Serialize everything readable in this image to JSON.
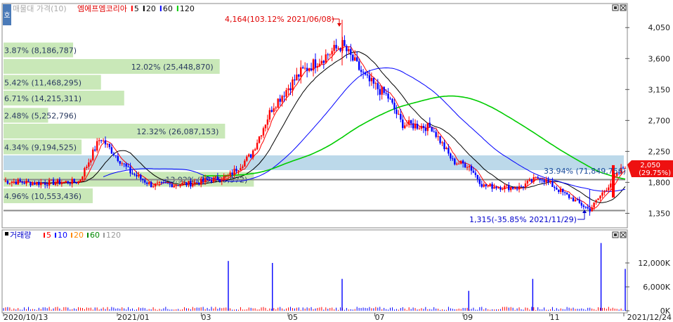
{
  "header": {
    "menu_label": "호",
    "title": "매물대 가격(10)",
    "stock_name": "엠에프엠코리아",
    "ma_legend": [
      {
        "label": "5",
        "color": "#ff0000"
      },
      {
        "label": "20",
        "color": "#000000"
      },
      {
        "label": "60",
        "color": "#0000ff"
      },
      {
        "label": "120",
        "color": "#00cc00"
      }
    ]
  },
  "volume_header": {
    "title": "거래량",
    "ma_legend": [
      {
        "label": "5",
        "color": "#ff0000"
      },
      {
        "label": "10",
        "color": "#0000ff"
      },
      {
        "label": "20",
        "color": "#ff8800"
      },
      {
        "label": "60",
        "color": "#008800"
      },
      {
        "label": "120",
        "color": "#999999"
      }
    ]
  },
  "annotations": {
    "high": "4,164(103.12% 2021/06/08)",
    "low": "1,315(-35.85% 2021/11/29)",
    "current_band": "33.94% (71,849,756)",
    "last_price": "2,050",
    "last_change": "(29.75%)"
  },
  "colors": {
    "up": "#ff0000",
    "down": "#0000ff",
    "ma5": "#ff0000",
    "ma20": "#000000",
    "ma60": "#0000ff",
    "ma120": "#00cc00",
    "profile": "#c9e8b8",
    "profile_current": "#bcd9ea"
  },
  "chart_data": [
    {
      "type": "candlestick",
      "title": "엠에프엠코리아",
      "x_tick_labels": [
        "2020/10/13",
        "2021/01",
        "03",
        "05",
        "07",
        "09",
        "11",
        "2021/12/24"
      ],
      "y_tick_labels": [
        "4,050",
        "3,600",
        "3,150",
        "2,700",
        "2,250",
        "1,800",
        "1,350"
      ],
      "ylim": [
        1150,
        4400
      ],
      "high": {
        "value": 4164,
        "pct": "103.12%",
        "date": "2021/06/08"
      },
      "low": {
        "value": 1315,
        "pct": "-35.85%",
        "date": "2021/11/29"
      },
      "last": {
        "value": 2050,
        "change_pct": "29.75%"
      },
      "moving_averages": [
        "5",
        "20",
        "60",
        "120"
      ],
      "price_reference_lines": [
        1840,
        1390
      ],
      "price_series_approx": [
        {
          "date": "2020-10-13",
          "close": 1820
        },
        {
          "date": "2020-11-05",
          "close": 1790
        },
        {
          "date": "2020-12-05",
          "close": 1810
        },
        {
          "date": "2020-12-20",
          "close": 2450
        },
        {
          "date": "2021-01-10",
          "close": 1950
        },
        {
          "date": "2021-01-25",
          "close": 1760
        },
        {
          "date": "2021-02-20",
          "close": 1780
        },
        {
          "date": "2021-03-20",
          "close": 1880
        },
        {
          "date": "2021-04-05",
          "close": 2200
        },
        {
          "date": "2021-04-20",
          "close": 2900
        },
        {
          "date": "2021-05-10",
          "close": 3400
        },
        {
          "date": "2021-06-08",
          "close": 3800
        },
        {
          "date": "2021-06-25",
          "close": 3300
        },
        {
          "date": "2021-07-10",
          "close": 3050
        },
        {
          "date": "2021-07-20",
          "close": 2650
        },
        {
          "date": "2021-08-10",
          "close": 2600
        },
        {
          "date": "2021-08-25",
          "close": 2100
        },
        {
          "date": "2021-09-05",
          "close": 2050
        },
        {
          "date": "2021-09-15",
          "close": 1750
        },
        {
          "date": "2021-10-10",
          "close": 1720
        },
        {
          "date": "2021-10-25",
          "close": 1880
        },
        {
          "date": "2021-11-10",
          "close": 1650
        },
        {
          "date": "2021-11-29",
          "close": 1400
        },
        {
          "date": "2021-12-10",
          "close": 1700
        },
        {
          "date": "2021-12-24",
          "close": 2050
        }
      ],
      "volume_profile": [
        {
          "label": "3.87% (8,186,787)",
          "pct": 3.87,
          "price": 3720
        },
        {
          "label": "12.02% (25,448,870)",
          "pct": 12.02,
          "price": 3480
        },
        {
          "label": "5.42% (11,468,295)",
          "pct": 5.42,
          "price": 3250
        },
        {
          "label": "6.71% (14,215,311)",
          "pct": 6.71,
          "price": 3020
        },
        {
          "label": "2.48% (5,252,796)",
          "pct": 2.48,
          "price": 2770
        },
        {
          "label": "12.32% (26,087,153)",
          "pct": 12.32,
          "price": 2540
        },
        {
          "label": "4.34% (9,194,525)",
          "pct": 4.34,
          "price": 2310
        },
        {
          "label": "33.94% (71,849,756)",
          "pct": 33.94,
          "price": 2080,
          "current": true
        },
        {
          "label": "13.92% (29,465,972)",
          "pct": 13.92,
          "price": 1840
        },
        {
          "label": "4.96% (10,553,436)",
          "pct": 4.96,
          "price": 1600
        }
      ]
    },
    {
      "type": "bar",
      "title": "거래량",
      "y_tick_labels": [
        "12,000K",
        "6,000K",
        "0K"
      ],
      "ylim": [
        0,
        18000
      ],
      "volume_spikes_approx": [
        {
          "date": "2021-03-20",
          "value": 12500
        },
        {
          "date": "2021-04-20",
          "value": 12000
        },
        {
          "date": "2021-06-08",
          "value": 8000
        },
        {
          "date": "2021-09-05",
          "value": 5000
        },
        {
          "date": "2021-10-20",
          "value": 8000
        },
        {
          "date": "2021-12-07",
          "value": 17000
        },
        {
          "date": "2021-12-24",
          "value": 10500
        }
      ]
    }
  ]
}
